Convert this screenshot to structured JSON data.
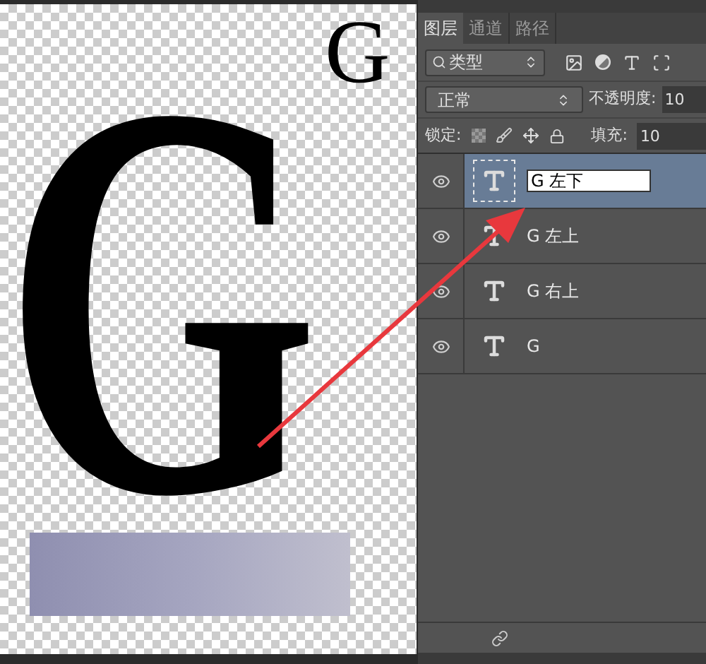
{
  "canvas": {
    "large_letter": "G",
    "small_letter": "G"
  },
  "panel": {
    "tabs": [
      {
        "label": "图层",
        "selected": true
      },
      {
        "label": "通道",
        "selected": false
      },
      {
        "label": "路径",
        "selected": false
      }
    ],
    "filter": {
      "value": "类型"
    },
    "blend": {
      "value": "正常",
      "opacity_label": "不透明度:",
      "opacity": "10"
    },
    "lock": {
      "label": "锁定:",
      "fill_label": "填充:",
      "fill": "10"
    },
    "layers": [
      {
        "name": "G 左下",
        "visible": true,
        "selected": true,
        "renaming": true
      },
      {
        "name": "G 左上",
        "visible": true,
        "selected": false,
        "renaming": false
      },
      {
        "name": "G 右上",
        "visible": true,
        "selected": false,
        "renaming": false
      },
      {
        "name": "G",
        "visible": true,
        "selected": false,
        "renaming": false
      }
    ]
  }
}
